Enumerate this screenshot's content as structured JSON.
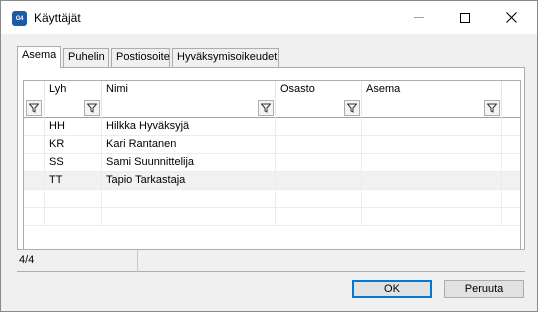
{
  "window": {
    "app_icon_text": "G4",
    "title": "Käyttäjät",
    "accent": "#1d5aa8"
  },
  "tabs": [
    {
      "label": "Asema",
      "active": true
    },
    {
      "label": "Puhelin",
      "active": false
    },
    {
      "label": "Postiosoite",
      "active": false
    },
    {
      "label": "Hyväksymisoikeudet",
      "active": false
    }
  ],
  "grid": {
    "columns": [
      "Lyh",
      "Nimi",
      "Osasto",
      "Asema"
    ],
    "filter_icon": "funnel-icon",
    "rows": [
      {
        "lyh": "HH",
        "nimi": "Hilkka Hyväksyjä",
        "osasto": "",
        "asema": ""
      },
      {
        "lyh": "KR",
        "nimi": "Kari Rantanen",
        "osasto": "",
        "asema": ""
      },
      {
        "lyh": "SS",
        "nimi": "Sami Suunnittelija",
        "osasto": "",
        "asema": ""
      },
      {
        "lyh": "TT",
        "nimi": "Tapio Tarkastaja",
        "osasto": "",
        "asema": "",
        "selected": true
      }
    ]
  },
  "status": {
    "record_count": "4/4"
  },
  "buttons": {
    "ok": "OK",
    "cancel": "Peruuta"
  }
}
